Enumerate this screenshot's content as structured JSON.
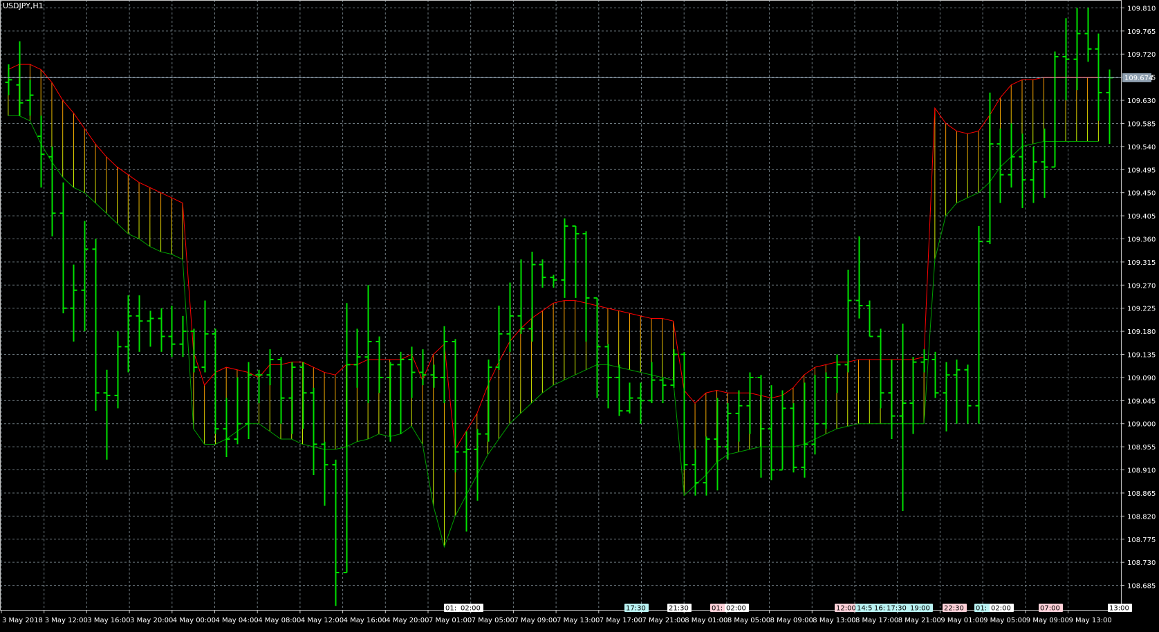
{
  "window": {
    "title": "USDJPY,H1"
  },
  "colors": {
    "background": "#000000",
    "grid": "#6e7a80",
    "bar": "#00e000",
    "upper_line": "#ff0000",
    "lower_line": "#00a000",
    "price_line": "#8fa0b0",
    "fill_top": "#ff8c00",
    "fill_bottom": "#c8ff00",
    "axis_text": "#ffffff"
  },
  "current_price": "109.674",
  "price_axis": [
    "109.810",
    "109.765",
    "109.720",
    "109.675",
    "109.630",
    "109.585",
    "109.540",
    "109.495",
    "109.450",
    "109.405",
    "109.360",
    "109.315",
    "109.270",
    "109.225",
    "109.180",
    "109.135",
    "109.090",
    "109.045",
    "109.000",
    "108.955",
    "108.910",
    "108.865",
    "108.820",
    "108.775",
    "108.730",
    "108.685"
  ],
  "time_axis": [
    "3 May 2018",
    "3 May 12:00",
    "3 May 16:00",
    "3 May 20:00",
    "4 May 00:00",
    "4 May 04:00",
    "4 May 08:00",
    "4 May 12:00",
    "4 May 16:00",
    "4 May 20:00",
    "7 May 01:00",
    "7 May 05:00",
    "7 May 09:00",
    "7 May 13:00",
    "7 May 17:00",
    "7 May 21:00",
    "8 May 01:00",
    "8 May 05:00",
    "8 May 09:00",
    "8 May 13:00",
    "8 May 17:00",
    "8 May 21:00",
    "9 May 01:00",
    "9 May 05:00",
    "9 May 09:00",
    "9 May 13:00"
  ],
  "event_markers": [
    {
      "label": "01:",
      "color": "#ffffff"
    },
    {
      "label": "02:00",
      "color": "#ffffff"
    },
    {
      "label": "17:30",
      "color": "#b9f2f2"
    },
    {
      "label": "21:30",
      "color": "#ffffff"
    },
    {
      "label": "01:",
      "color": "#ffd0d8"
    },
    {
      "label": "02:00",
      "color": "#ffffff"
    },
    {
      "label": "12:00",
      "color": "#ffd0d8"
    },
    {
      "label": "14:55",
      "color": "#b9f2f2"
    },
    {
      "label": "16:",
      "color": "#b9f2f2"
    },
    {
      "label": "17:30",
      "color": "#b9f2f2"
    },
    {
      "label": "19:00",
      "color": "#b9f2f2"
    },
    {
      "label": "22:30",
      "color": "#ffd0d8"
    },
    {
      "label": "01:",
      "color": "#b9f2f2"
    },
    {
      "label": "02:00",
      "color": "#ffffff"
    },
    {
      "label": "07:00",
      "color": "#ffd0d8"
    },
    {
      "label": "13:00",
      "color": "#ffffff"
    }
  ],
  "chart_data": {
    "type": "ohlc",
    "symbol": "USDJPY",
    "timeframe": "H1",
    "ylim": [
      108.64,
      109.82
    ],
    "bars": [
      {
        "o": 109.665,
        "h": 109.7,
        "l": 109.64,
        "c": 109.67
      },
      {
        "o": 109.66,
        "h": 109.745,
        "l": 109.6,
        "c": 109.625
      },
      {
        "o": 109.63,
        "h": 109.67,
        "l": 109.6,
        "c": 109.64
      },
      {
        "o": 109.56,
        "h": 109.6,
        "l": 109.46,
        "c": 109.525
      },
      {
        "o": 109.52,
        "h": 109.54,
        "l": 109.365,
        "c": 109.41
      },
      {
        "o": 109.41,
        "h": 109.47,
        "l": 109.215,
        "c": 109.225
      },
      {
        "o": 109.225,
        "h": 109.31,
        "l": 109.16,
        "c": 109.26
      },
      {
        "o": 109.26,
        "h": 109.395,
        "l": 109.18,
        "c": 109.34
      },
      {
        "o": 109.34,
        "h": 109.36,
        "l": 109.025,
        "c": 109.06
      },
      {
        "o": 109.06,
        "h": 109.105,
        "l": 108.93,
        "c": 109.055
      },
      {
        "o": 109.055,
        "h": 109.18,
        "l": 109.03,
        "c": 109.15
      },
      {
        "o": 109.15,
        "h": 109.25,
        "l": 109.1,
        "c": 109.21
      },
      {
        "o": 109.21,
        "h": 109.25,
        "l": 109.14,
        "c": 109.2
      },
      {
        "o": 109.2,
        "h": 109.22,
        "l": 109.15,
        "c": 109.205
      },
      {
        "o": 109.205,
        "h": 109.225,
        "l": 109.14,
        "c": 109.17
      },
      {
        "o": 109.17,
        "h": 109.23,
        "l": 109.13,
        "c": 109.155
      },
      {
        "o": 109.155,
        "h": 109.21,
        "l": 109.13,
        "c": 109.18
      },
      {
        "o": 109.18,
        "h": 109.185,
        "l": 109.1,
        "c": 109.11
      },
      {
        "o": 109.11,
        "h": 109.24,
        "l": 109.1,
        "c": 109.175
      },
      {
        "o": 109.175,
        "h": 109.185,
        "l": 108.98,
        "c": 108.99
      },
      {
        "o": 108.99,
        "h": 109.05,
        "l": 108.935,
        "c": 108.97
      },
      {
        "o": 108.97,
        "h": 109.09,
        "l": 108.96,
        "c": 109.0
      },
      {
        "o": 109.0,
        "h": 109.12,
        "l": 108.97,
        "c": 109.095
      },
      {
        "o": 109.095,
        "h": 109.105,
        "l": 109.04,
        "c": 109.095
      },
      {
        "o": 109.095,
        "h": 109.145,
        "l": 109.075,
        "c": 109.125
      },
      {
        "o": 109.125,
        "h": 109.13,
        "l": 109.0,
        "c": 109.05
      },
      {
        "o": 109.05,
        "h": 109.12,
        "l": 108.98,
        "c": 109.11
      },
      {
        "o": 109.11,
        "h": 109.12,
        "l": 108.99,
        "c": 109.06
      },
      {
        "o": 109.06,
        "h": 109.07,
        "l": 108.9,
        "c": 108.96
      },
      {
        "o": 108.96,
        "h": 108.965,
        "l": 108.84,
        "c": 108.92
      },
      {
        "o": 108.92,
        "h": 108.93,
        "l": 108.645,
        "c": 108.71
      },
      {
        "o": 108.71,
        "h": 109.235,
        "l": 108.71,
        "c": 109.115
      },
      {
        "o": 109.115,
        "h": 109.185,
        "l": 109.07,
        "c": 109.13
      },
      {
        "o": 109.13,
        "h": 109.27,
        "l": 109.04,
        "c": 109.16
      },
      {
        "o": 109.16,
        "h": 109.17,
        "l": 109.06,
        "c": 109.09
      },
      {
        "o": 109.09,
        "h": 109.12,
        "l": 108.965,
        "c": 109.115
      },
      {
        "o": 109.115,
        "h": 109.14,
        "l": 108.98,
        "c": 109.125
      },
      {
        "o": 109.125,
        "h": 109.15,
        "l": 109.05,
        "c": 109.1
      },
      {
        "o": 109.1,
        "h": 109.145,
        "l": 109.075,
        "c": 109.095
      },
      {
        "o": 109.095,
        "h": 109.115,
        "l": 109.07,
        "c": 109.09
      },
      {
        "o": 109.09,
        "h": 109.19,
        "l": 109.04,
        "c": 109.16
      },
      {
        "o": 109.16,
        "h": 109.165,
        "l": 108.905,
        "c": 108.945
      },
      {
        "o": 108.945,
        "h": 108.985,
        "l": 108.79,
        "c": 108.95
      },
      {
        "o": 108.95,
        "h": 108.99,
        "l": 108.85,
        "c": 108.98
      },
      {
        "o": 108.98,
        "h": 109.125,
        "l": 108.965,
        "c": 109.11
      },
      {
        "o": 109.11,
        "h": 109.23,
        "l": 109.105,
        "c": 109.175
      },
      {
        "o": 109.175,
        "h": 109.275,
        "l": 109.14,
        "c": 109.21
      },
      {
        "o": 109.21,
        "h": 109.32,
        "l": 109.175,
        "c": 109.185
      },
      {
        "o": 109.185,
        "h": 109.335,
        "l": 109.16,
        "c": 109.31
      },
      {
        "o": 109.31,
        "h": 109.32,
        "l": 109.265,
        "c": 109.285
      },
      {
        "o": 109.285,
        "h": 109.29,
        "l": 109.265,
        "c": 109.28
      },
      {
        "o": 109.28,
        "h": 109.4,
        "l": 109.245,
        "c": 109.385
      },
      {
        "o": 109.385,
        "h": 109.385,
        "l": 109.245,
        "c": 109.37
      },
      {
        "o": 109.37,
        "h": 109.375,
        "l": 109.16,
        "c": 109.245
      },
      {
        "o": 109.245,
        "h": 109.245,
        "l": 109.05,
        "c": 109.15
      },
      {
        "o": 109.15,
        "h": 109.155,
        "l": 109.03,
        "c": 109.09
      },
      {
        "o": 109.09,
        "h": 109.115,
        "l": 109.015,
        "c": 109.025
      },
      {
        "o": 109.025,
        "h": 109.08,
        "l": 109.02,
        "c": 109.05
      },
      {
        "o": 109.05,
        "h": 109.08,
        "l": 109.0,
        "c": 109.045
      },
      {
        "o": 109.045,
        "h": 109.12,
        "l": 109.04,
        "c": 109.085
      },
      {
        "o": 109.085,
        "h": 109.09,
        "l": 109.04,
        "c": 109.075
      },
      {
        "o": 109.075,
        "h": 109.145,
        "l": 109.07,
        "c": 109.135
      },
      {
        "o": 109.135,
        "h": 109.14,
        "l": 108.91,
        "c": 108.92
      },
      {
        "o": 108.92,
        "h": 108.95,
        "l": 108.86,
        "c": 108.885
      },
      {
        "o": 108.885,
        "h": 108.975,
        "l": 108.86,
        "c": 108.97
      },
      {
        "o": 108.97,
        "h": 109.05,
        "l": 108.87,
        "c": 108.955
      },
      {
        "o": 108.955,
        "h": 109.04,
        "l": 108.93,
        "c": 109.02
      },
      {
        "o": 109.02,
        "h": 109.065,
        "l": 108.965,
        "c": 109.035
      },
      {
        "o": 109.035,
        "h": 109.1,
        "l": 108.98,
        "c": 109.09
      },
      {
        "o": 109.09,
        "h": 109.095,
        "l": 108.895,
        "c": 108.99
      },
      {
        "o": 108.99,
        "h": 109.075,
        "l": 108.89,
        "c": 108.91
      },
      {
        "o": 108.91,
        "h": 109.065,
        "l": 108.91,
        "c": 109.03
      },
      {
        "o": 109.03,
        "h": 109.04,
        "l": 108.905,
        "c": 108.915
      },
      {
        "o": 108.915,
        "h": 109.08,
        "l": 108.895,
        "c": 108.96
      },
      {
        "o": 108.96,
        "h": 109.095,
        "l": 108.94,
        "c": 109.0
      },
      {
        "o": 109.0,
        "h": 109.1,
        "l": 108.99,
        "c": 109.09
      },
      {
        "o": 109.09,
        "h": 109.135,
        "l": 109.06,
        "c": 109.115
      },
      {
        "o": 109.115,
        "h": 109.3,
        "l": 109.1,
        "c": 109.24
      },
      {
        "o": 109.24,
        "h": 109.365,
        "l": 109.205,
        "c": 109.23
      },
      {
        "o": 109.23,
        "h": 109.24,
        "l": 109.17,
        "c": 109.17
      },
      {
        "o": 109.17,
        "h": 109.185,
        "l": 109.03,
        "c": 109.06
      },
      {
        "o": 109.06,
        "h": 109.125,
        "l": 108.97,
        "c": 109.015
      },
      {
        "o": 109.015,
        "h": 109.195,
        "l": 108.83,
        "c": 109.04
      },
      {
        "o": 109.04,
        "h": 109.13,
        "l": 108.98,
        "c": 109.12
      },
      {
        "o": 109.12,
        "h": 109.145,
        "l": 109.1,
        "c": 109.125
      },
      {
        "o": 109.125,
        "h": 109.14,
        "l": 109.05,
        "c": 109.06
      },
      {
        "o": 109.06,
        "h": 109.12,
        "l": 108.985,
        "c": 109.095
      },
      {
        "o": 109.095,
        "h": 109.125,
        "l": 109.0,
        "c": 109.105
      },
      {
        "o": 109.105,
        "h": 109.115,
        "l": 109.0,
        "c": 109.035
      },
      {
        "o": 109.035,
        "h": 109.385,
        "l": 109.0,
        "c": 109.355
      },
      {
        "o": 109.355,
        "h": 109.645,
        "l": 109.35,
        "c": 109.545
      },
      {
        "o": 109.545,
        "h": 109.575,
        "l": 109.43,
        "c": 109.485
      },
      {
        "o": 109.485,
        "h": 109.585,
        "l": 109.46,
        "c": 109.52
      },
      {
        "o": 109.52,
        "h": 109.565,
        "l": 109.42,
        "c": 109.475
      },
      {
        "o": 109.475,
        "h": 109.54,
        "l": 109.43,
        "c": 109.51
      },
      {
        "o": 109.51,
        "h": 109.575,
        "l": 109.44,
        "c": 109.5
      },
      {
        "o": 109.5,
        "h": 109.725,
        "l": 109.5,
        "c": 109.715
      },
      {
        "o": 109.715,
        "h": 109.79,
        "l": 109.63,
        "c": 109.71
      },
      {
        "o": 109.71,
        "h": 109.81,
        "l": 109.65,
        "c": 109.76
      },
      {
        "o": 109.76,
        "h": 109.81,
        "l": 109.705,
        "c": 109.73
      },
      {
        "o": 109.73,
        "h": 109.76,
        "l": 109.59,
        "c": 109.645
      },
      {
        "o": 109.645,
        "h": 109.69,
        "l": 109.545,
        "c": 109.674
      }
    ],
    "upper_band": [
      109.69,
      109.7,
      109.7,
      109.69,
      109.665,
      109.63,
      109.605,
      109.575,
      109.545,
      109.52,
      109.5,
      109.485,
      109.47,
      109.46,
      109.45,
      109.44,
      109.43,
      109.14,
      109.075,
      109.1,
      109.11,
      109.105,
      109.1,
      109.09,
      109.115,
      109.115,
      109.12,
      109.12,
      109.11,
      109.1,
      109.095,
      109.115,
      109.115,
      109.125,
      109.125,
      109.125,
      109.125,
      109.135,
      109.085,
      109.135,
      109.155,
      108.95,
      108.985,
      109.02,
      109.075,
      109.12,
      109.16,
      109.185,
      109.205,
      109.22,
      109.235,
      109.24,
      109.24,
      109.235,
      109.23,
      109.225,
      109.22,
      109.215,
      109.21,
      109.205,
      109.205,
      109.2,
      109.065,
      109.04,
      109.06,
      109.065,
      109.06,
      109.06,
      109.06,
      109.055,
      109.05,
      109.055,
      109.07,
      109.095,
      109.11,
      109.115,
      109.12,
      109.12,
      109.125,
      109.125,
      109.125,
      109.125,
      109.125,
      109.125,
      109.13,
      109.615,
      109.585,
      109.57,
      109.565,
      109.57,
      109.6,
      109.635,
      109.66,
      109.67,
      109.67,
      109.675,
      109.675,
      109.675,
      109.675,
      109.675,
      109.675
    ],
    "lower_band": [
      109.6,
      109.6,
      109.59,
      109.545,
      109.51,
      109.48,
      109.46,
      109.45,
      109.43,
      109.41,
      109.39,
      109.37,
      109.36,
      109.345,
      109.335,
      109.33,
      109.32,
      108.99,
      108.96,
      108.96,
      108.97,
      108.985,
      109.0,
      109.0,
      108.985,
      108.97,
      108.97,
      108.96,
      108.955,
      108.95,
      108.95,
      108.955,
      108.965,
      108.97,
      108.98,
      108.975,
      108.98,
      108.995,
      108.96,
      108.84,
      108.76,
      108.82,
      108.86,
      108.9,
      108.94,
      108.97,
      109.0,
      109.02,
      109.04,
      109.06,
      109.075,
      109.085,
      109.095,
      109.105,
      109.115,
      109.115,
      109.11,
      109.105,
      109.1,
      109.095,
      109.09,
      109.085,
      108.86,
      108.88,
      108.9,
      108.925,
      108.94,
      108.945,
      108.95,
      108.955,
      108.955,
      108.955,
      108.955,
      108.96,
      108.97,
      108.98,
      108.99,
      108.995,
      109.0,
      109.0,
      109.0,
      109.0,
      109.0,
      109.0,
      109.0,
      109.32,
      109.405,
      109.43,
      109.44,
      109.45,
      109.47,
      109.5,
      109.52,
      109.54,
      109.545,
      109.55,
      109.55,
      109.55,
      109.55,
      109.55,
      109.55
    ]
  }
}
